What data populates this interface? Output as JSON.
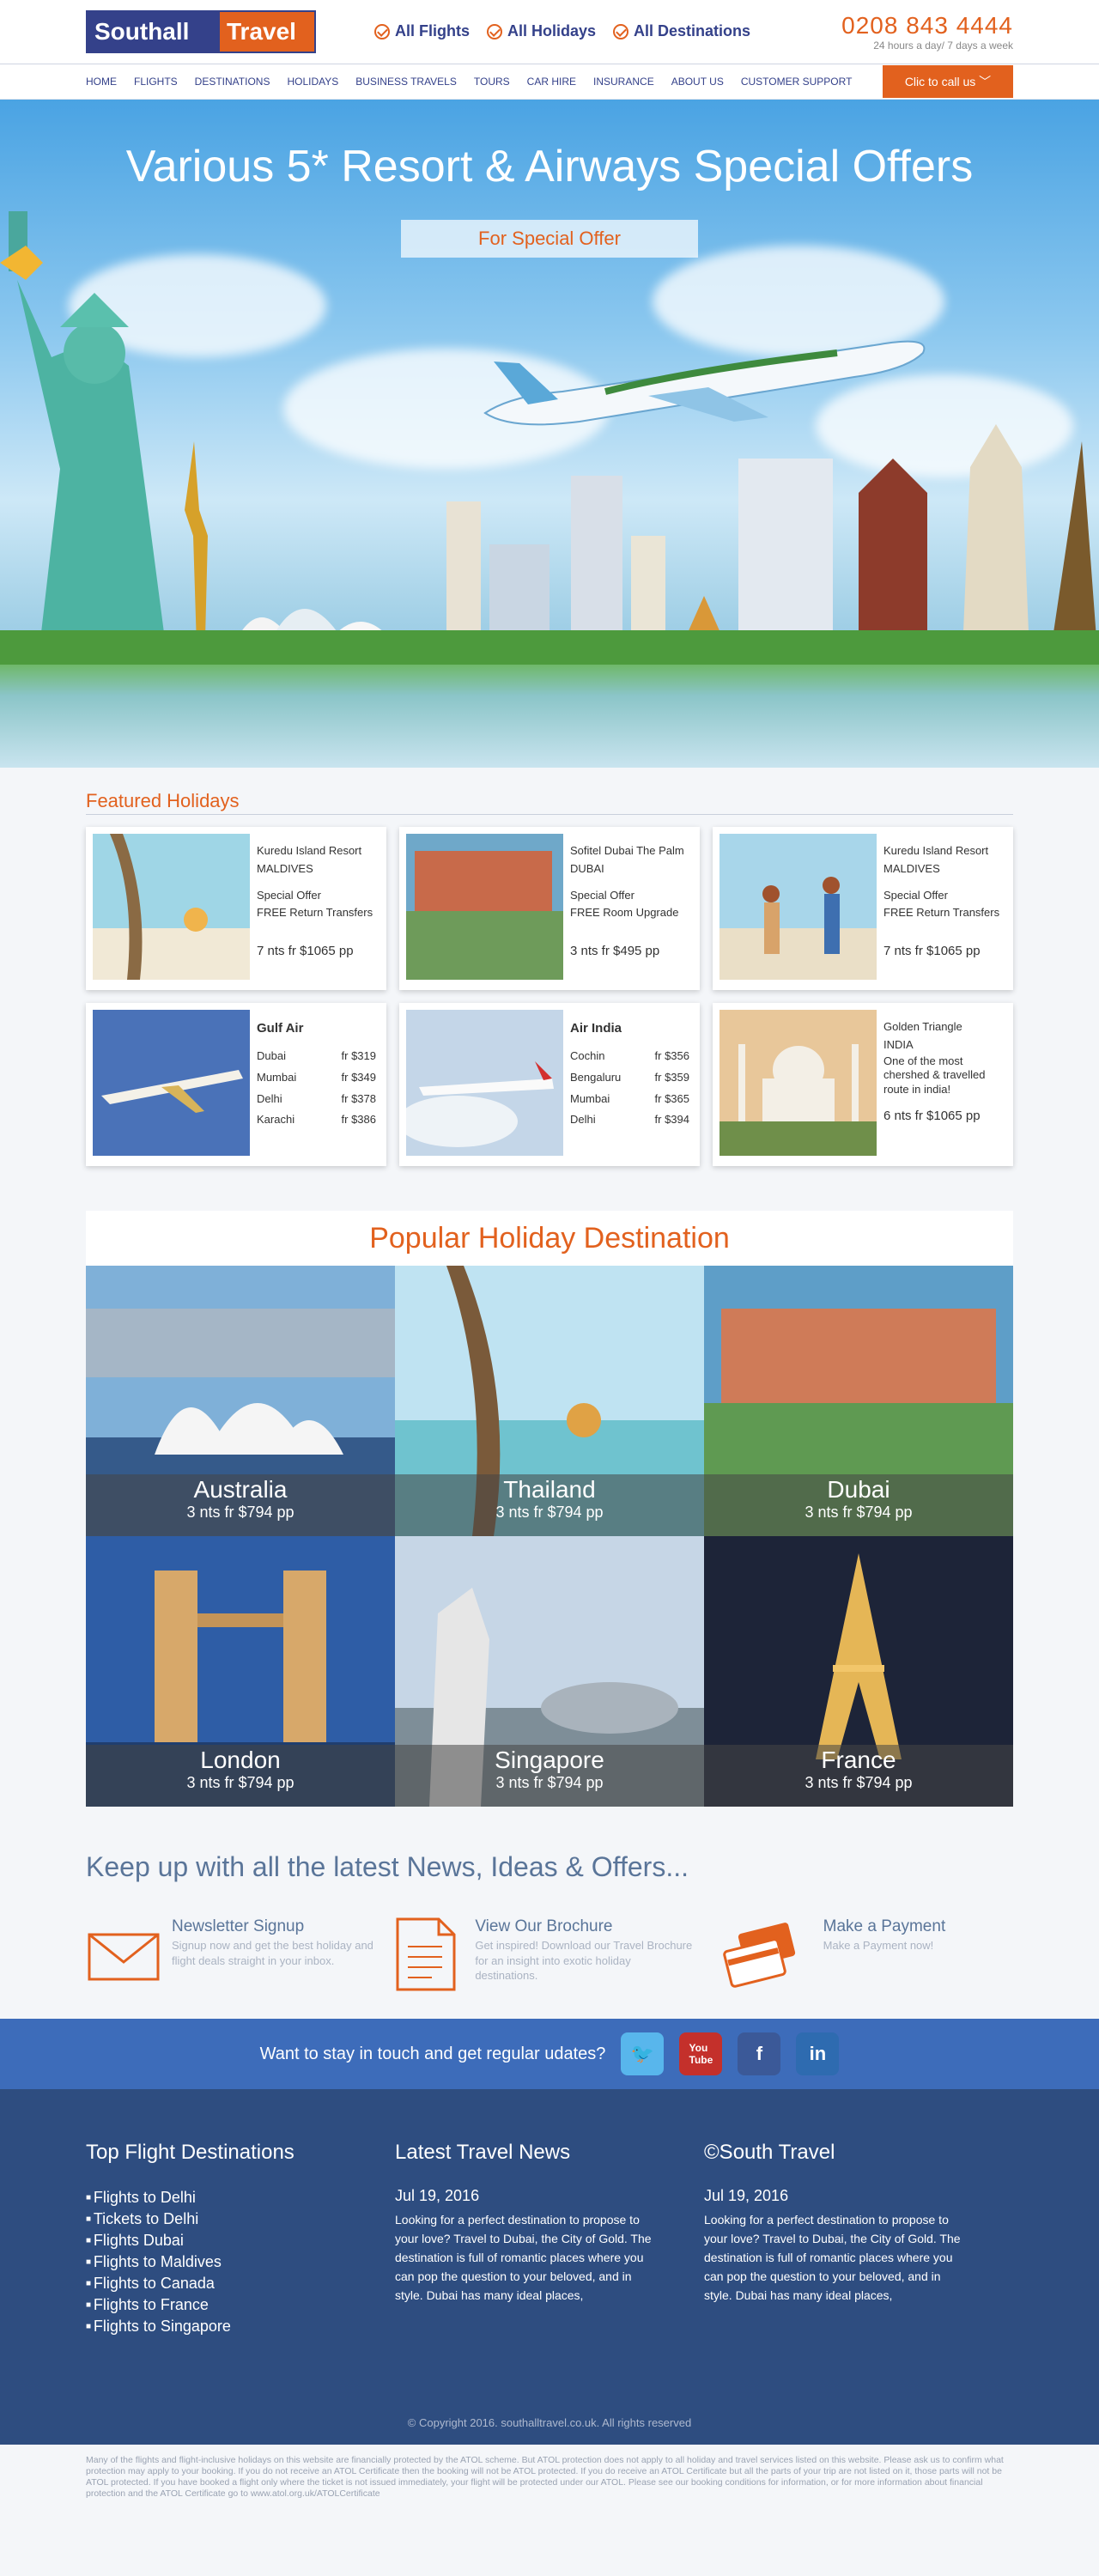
{
  "header": {
    "logo_left": "Southall",
    "logo_right": "Travel",
    "usps": [
      "All Flights",
      "All Holidays",
      "All Destinations"
    ],
    "phone": "0208 843 4444",
    "hours": "24 hours a day/ 7 days a week",
    "call_button": "Clic to call us ﹀"
  },
  "nav": [
    "HOME",
    "FLIGHTS",
    "DESTINATIONS",
    "HOLIDAYS",
    "BUSINESS TRAVELS",
    "TOURS",
    "CAR HIRE",
    "INSURANCE",
    "ABOUT US",
    "CUSTOMER SUPPORT"
  ],
  "hero": {
    "title": "Various 5* Resort & Airways Special Offers",
    "button": "For Special Offer"
  },
  "featured": {
    "title": "Featured Holidays",
    "cards": [
      {
        "name": "Kuredu Island Resort",
        "place": "MALDIVES",
        "offer": "Special Offer",
        "extra": "FREE Return Transfers",
        "price": "7 nts fr $1065 pp"
      },
      {
        "name": "Sofitel Dubai The Palm",
        "place": "DUBAI",
        "offer": "Special Offer",
        "extra": "FREE Room Upgrade",
        "price": "3 nts fr $495 pp"
      },
      {
        "name": "Kuredu Island Resort",
        "place": "MALDIVES",
        "offer": "Special Offer",
        "extra": "FREE Return Transfers",
        "price": "7 nts fr $1065 pp"
      }
    ],
    "airlines": [
      {
        "name": "Gulf Air",
        "routes": [
          [
            "Dubai",
            "fr $319"
          ],
          [
            "Mumbai",
            "fr $349"
          ],
          [
            "Delhi",
            "fr $378"
          ],
          [
            "Karachi",
            "fr $386"
          ]
        ]
      },
      {
        "name": "Air India",
        "routes": [
          [
            "Cochin",
            "fr $356"
          ],
          [
            "Bengaluru",
            "fr $359"
          ],
          [
            "Mumbai",
            "fr $365"
          ],
          [
            "Delhi",
            "fr $394"
          ]
        ]
      }
    ],
    "tour": {
      "name": "Golden Triangle",
      "place": "INDIA",
      "desc": "One of the most chershed & travelled route in india!",
      "price": "6 nts fr $1065 pp"
    }
  },
  "popular": {
    "title": "Popular Holiday Destination",
    "items": [
      {
        "name": "Australia",
        "price": "3 nts fr $794 pp"
      },
      {
        "name": "Thailand",
        "price": "3 nts fr $794 pp"
      },
      {
        "name": "Dubai",
        "price": "3 nts fr $794 pp"
      },
      {
        "name": "London",
        "price": "3 nts fr $794 pp"
      },
      {
        "name": "Singapore",
        "price": "3 nts fr $794 pp"
      },
      {
        "name": "France",
        "price": "3 nts fr $794 pp"
      }
    ]
  },
  "news": {
    "title": "Keep up with all the latest News, Ideas & Offers...",
    "features": [
      {
        "title": "Newsletter Signup",
        "text": "Signup now and get the best holiday and flight deals straight in your inbox."
      },
      {
        "title": "View Our Brochure",
        "text": "Get inspired! Download our Travel Brochure for an insight into exotic holiday destinations."
      },
      {
        "title": "Make a Payment",
        "text": "Make a Payment now!"
      }
    ]
  },
  "social": {
    "text": "Want to stay in touch and get regular udates?",
    "networks": [
      "twitter-icon",
      "youtube-icon",
      "facebook-icon",
      "linkedin-icon"
    ]
  },
  "footer": {
    "col1_title": "Top Flight Destinations",
    "links": [
      "Flights to Delhi",
      "Tickets to Delhi",
      "Flights Dubai",
      "Flights to Maldives",
      "Flights to Canada",
      "Flights to France",
      "Flights to Singapore"
    ],
    "col2_title": "Latest Travel News",
    "col2_date": "Jul 19, 2016",
    "col2_body": "Looking for a perfect destination to propose to your love? Travel to Dubai, the City of Gold. The destination is full of romantic places where you can pop the question to your beloved, and in style. Dubai has many ideal places,",
    "col3_title": "©South Travel",
    "col3_date": "Jul 19, 2016",
    "col3_body": "Looking for a perfect destination to propose to your love? Travel to Dubai, the City of Gold. The destination is full of romantic places where you can pop the question to your beloved, and in style. Dubai has many ideal places,",
    "copyright": "© Copyright 2016. southalltravel.co.uk. All rights reserved",
    "disclaimer": "Many of the flights and flight-inclusive holidays on this website are financially protected by the ATOL scheme. But ATOL protection does not apply to all holiday and travel services listed on this website. Please ask us to confirm what protection may apply to your booking. If you do not receive an ATOL Certificate then the booking will not be ATOL protected. If you do receive an ATOL Certificate but all the parts of your trip are not listed on it, those parts will not be ATOL protected. If you have booked a flight only where the ticket is not issued immediately, your flight will be protected under our ATOL. Please see our booking conditions for information, or for more information about financial protection and the ATOL Certificate go to www.atol.org.uk/ATOLCertificate"
  },
  "colors": {
    "brand_blue": "#34418a",
    "brand_orange": "#e2611e",
    "footer_blue": "#2e4d80",
    "social_blue": "#3d6cba"
  }
}
